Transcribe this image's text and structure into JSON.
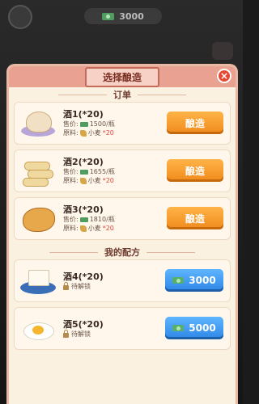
{
  "top": {
    "coins": "3000"
  },
  "modal": {
    "title": "选择酿造",
    "close": "×",
    "orders_header": "订单",
    "recipes_header": "我的配方",
    "orders": [
      {
        "name": "酒1(*20)",
        "price_label": "售价:",
        "price": "1500/瓶",
        "material_label": "原料:",
        "material": "小麦",
        "material_qty": "*20",
        "button": "酿造",
        "icon": "bun-icon"
      },
      {
        "name": "酒2(*20)",
        "price_label": "售价:",
        "price": "1655/瓶",
        "material_label": "原料:",
        "material": "小麦",
        "material_qty": "*20",
        "button": "酿造",
        "icon": "roll-icon"
      },
      {
        "name": "酒3(*20)",
        "price_label": "售价:",
        "price": "1810/瓶",
        "material_label": "原料:",
        "material": "小麦",
        "material_qty": "*20",
        "button": "酿造",
        "icon": "pastry-icon"
      }
    ],
    "recipes": [
      {
        "name": "酒4(*20)",
        "status": "待解锁",
        "price": "3000",
        "icon": "tofu-icon"
      },
      {
        "name": "酒5(*20)",
        "status": "待解锁",
        "price": "5000",
        "icon": "egg-icon"
      }
    ]
  },
  "colors": {
    "brew_button": "#f08a1c",
    "buy_button": "#2d86e6",
    "header": "#e9a292",
    "panel": "#fbf1e1"
  }
}
